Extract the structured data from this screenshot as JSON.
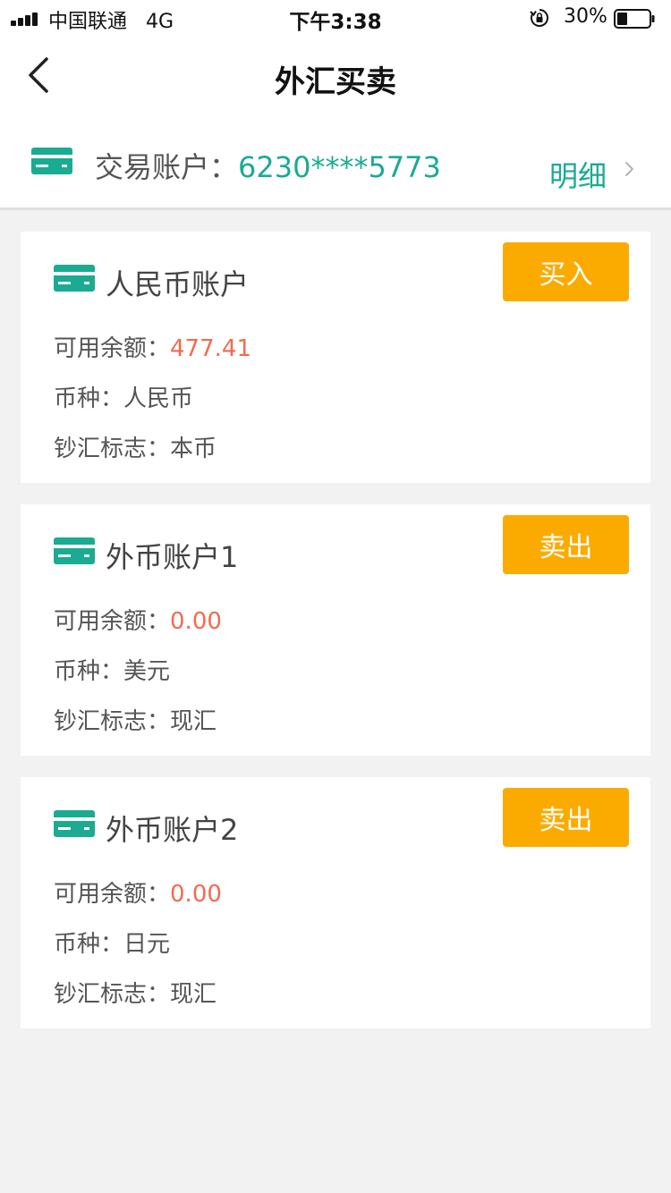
{
  "status_bar": {
    "carrier": "中国联通",
    "network": "4G",
    "time": "下午3:38",
    "battery": "30%"
  },
  "nav": {
    "title": "外汇买卖",
    "back_icon": "chevron-left-icon"
  },
  "account": {
    "label": "交易账户：",
    "number": "6230****5773",
    "detail_label": "明细",
    "icon": "card-icon"
  },
  "accounts": [
    {
      "title": "人民币账户",
      "button": "买入",
      "balance_label": "可用余额：",
      "balance": "477.41",
      "currency_label": "币种：",
      "currency": "人民币",
      "flag_label": "钞汇标志：",
      "flag": "本币"
    },
    {
      "title": "外币账户1",
      "button": "卖出",
      "balance_label": "可用余额：",
      "balance": "0.00",
      "currency_label": "币种：",
      "currency": "美元",
      "flag_label": "钞汇标志：",
      "flag": "现汇"
    },
    {
      "title": "外币账户2",
      "button": "卖出",
      "balance_label": "可用余额：",
      "balance": "0.00",
      "currency_label": "币种：",
      "currency": "日元",
      "flag_label": "钞汇标志：",
      "flag": "现汇"
    }
  ],
  "colors": {
    "accent": "#1aab92",
    "button": "#fbab00",
    "amount": "#f26b4f",
    "background": "#f2f2f2"
  }
}
